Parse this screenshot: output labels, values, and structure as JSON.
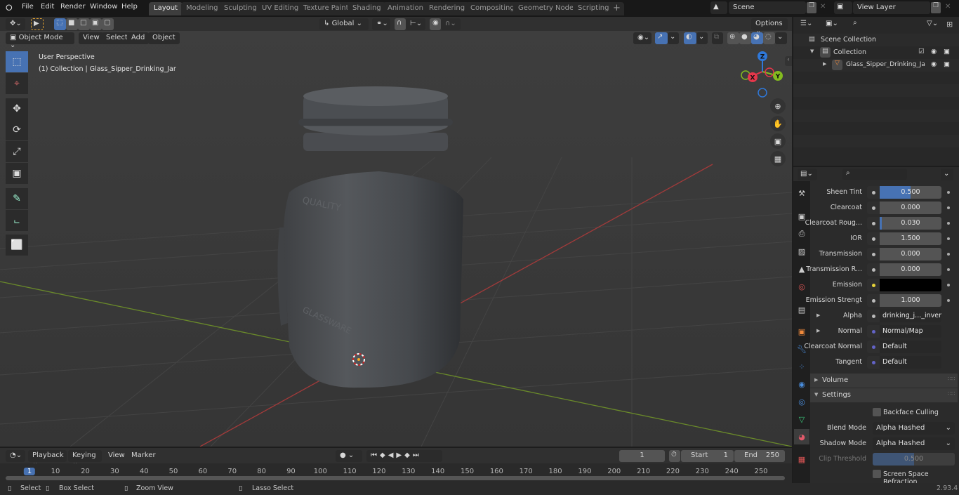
{
  "top_menu": {
    "items": [
      "File",
      "Edit",
      "Render",
      "Window",
      "Help"
    ],
    "workspace_tabs": [
      "Layout",
      "Modeling",
      "Sculpting",
      "UV Editing",
      "Texture Paint",
      "Shading",
      "Animation",
      "Rendering",
      "Compositing",
      "Geometry Nodes",
      "Scripting"
    ],
    "active_tab": "Layout",
    "add_tab_label": "+",
    "scene_name": "Scene",
    "view_layer_name": "View Layer"
  },
  "viewport_header": {
    "transform_orientation": "Global",
    "options_label": "Options",
    "mode": "Object Mode",
    "menus": [
      "View",
      "Select",
      "Add",
      "Object"
    ]
  },
  "viewport": {
    "view_name": "User Perspective",
    "context": "(1) Collection | Glass_Sipper_Drinking_Jar",
    "gizmo_axes": {
      "x": "X",
      "y": "Y",
      "z": "Z"
    },
    "colors": {
      "x_axis": "#e5374b",
      "y_axis": "#84bc1f",
      "z_axis": "#2f78d9",
      "active": "#4772b3"
    },
    "tools": [
      "select-box",
      "cursor",
      "move",
      "rotate",
      "scale",
      "transform",
      "annotate",
      "measure",
      "add-cube"
    ]
  },
  "outliner": {
    "search_placeholder": "",
    "scene_collection": "Scene Collection",
    "collection": "Collection",
    "object": "Glass_Sipper_Drinking_Ja"
  },
  "properties": {
    "search_placeholder": "",
    "rows": [
      {
        "label": "Sheen Tint",
        "value": "0.500",
        "fill": 0.5,
        "socket": "grey"
      },
      {
        "label": "Clearcoat",
        "value": "0.000",
        "fill": 0,
        "socket": "grey"
      },
      {
        "label": "Clearcoat Roug...",
        "value": "0.030",
        "fill": 0.03,
        "socket": "grey"
      },
      {
        "label": "IOR",
        "value": "1.500",
        "fill": 0,
        "socket": "grey"
      },
      {
        "label": "Transmission",
        "value": "0.000",
        "fill": 0,
        "socket": "grey"
      },
      {
        "label": "Transmission R...",
        "value": "0.000",
        "fill": 0,
        "socket": "grey"
      },
      {
        "label": "Emission",
        "value": "",
        "color": "#000000",
        "socket": "yellow"
      },
      {
        "label": "Emission Strengt",
        "value": "1.000",
        "fill": 0,
        "socket": "grey"
      },
      {
        "label": "Alpha",
        "value": "drinking_j..._invert.pn",
        "link": true,
        "socket": "grey",
        "expandable": true
      },
      {
        "label": "Normal",
        "value": "Normal/Map",
        "link": true,
        "socket": "purple",
        "expandable": true
      },
      {
        "label": "Clearcoat Normal",
        "value": "Default",
        "link": true,
        "socket": "purple"
      },
      {
        "label": "Tangent",
        "value": "Default",
        "link": true,
        "socket": "purple"
      }
    ],
    "panels": {
      "volume": "Volume",
      "settings": "Settings"
    },
    "settings": {
      "backface_culling_label": "Backface Culling",
      "backface_culling": false,
      "blend_mode_label": "Blend Mode",
      "blend_mode": "Alpha Hashed",
      "shadow_mode_label": "Shadow Mode",
      "shadow_mode": "Alpha Hashed",
      "clip_threshold_label": "Clip Threshold",
      "clip_threshold": "0.500",
      "clip_fill": 0.5,
      "ssr_label": "Screen Space Refraction",
      "ssr": false
    }
  },
  "timeline": {
    "menus": [
      "Playback",
      "Keying",
      "View",
      "Marker"
    ],
    "current_frame": "1",
    "start_label": "Start",
    "start": "1",
    "end_label": "End",
    "end": "250",
    "ticks": [
      "1",
      "10",
      "20",
      "30",
      "40",
      "50",
      "60",
      "70",
      "80",
      "90",
      "100",
      "110",
      "120",
      "130",
      "140",
      "150",
      "160",
      "170",
      "180",
      "190",
      "200",
      "210",
      "220",
      "230",
      "240",
      "250"
    ]
  },
  "statusbar": {
    "select": "Select",
    "box_select": "Box Select",
    "zoom_view": "Zoom View",
    "lasso_select": "Lasso Select",
    "version": "2.93.4"
  }
}
